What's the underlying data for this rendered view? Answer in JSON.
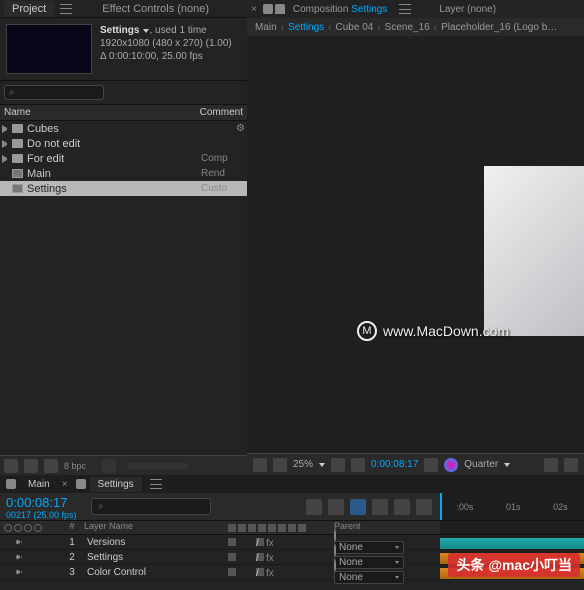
{
  "project_panel": {
    "tabs": {
      "project": "Project",
      "effect_controls": "Effect Controls",
      "ec_target": "(none)"
    },
    "comp_preview": {
      "name": "Settings",
      "usage": ", used 1 time",
      "dimensions": "1920x1080 (480 x 270) (1.00)",
      "duration": "Δ 0:00:10:00, 25.00 fps"
    },
    "search_placeholder": "⌕",
    "columns": {
      "name": "Name",
      "comment": "Comment"
    },
    "items": [
      {
        "label": "Cubes",
        "type": "folder",
        "meta": ""
      },
      {
        "label": "Do not edit",
        "type": "folder",
        "meta": ""
      },
      {
        "label": "For edit",
        "type": "folder",
        "meta": "Comp"
      },
      {
        "label": "Main",
        "type": "comp",
        "meta": "Rend"
      },
      {
        "label": "Settings",
        "type": "comp",
        "meta": "Custo",
        "selected": true
      }
    ],
    "bpc": "8 bpc"
  },
  "comp_panel": {
    "tabs": {
      "composition": "Composition",
      "current": "Settings",
      "layer": "Layer",
      "layer_target": "(none)"
    },
    "breadcrumb": [
      "Main",
      "Settings",
      "Cube 04",
      "Scene_16",
      "Placeholder_16 (Logo b…"
    ],
    "active_crumb": "Settings",
    "watermark": "www.MacDown.com"
  },
  "viewer_footer": {
    "zoom": "25%",
    "time": "0:00:08:17",
    "quality": "Quarter"
  },
  "timeline": {
    "tabs": [
      {
        "label": "Main",
        "active": false
      },
      {
        "label": "Settings",
        "active": true
      }
    ],
    "time_main": "0:00:08:17",
    "time_sub": "00217 (25.00 fps)",
    "search_placeholder": "⌕",
    "ruler": [
      ":00s",
      "01s",
      "02s"
    ],
    "cols": {
      "num": "#",
      "layer_name": "Layer Name",
      "parent": "Parent"
    },
    "parent_none": "None",
    "layers": [
      {
        "num": "1",
        "name": "Versions",
        "color": "teal"
      },
      {
        "num": "2",
        "name": "Settings",
        "color": "orange"
      },
      {
        "num": "3",
        "name": "Color Control",
        "color": "orange"
      }
    ]
  },
  "attribution": "头条 @mac小叮当"
}
